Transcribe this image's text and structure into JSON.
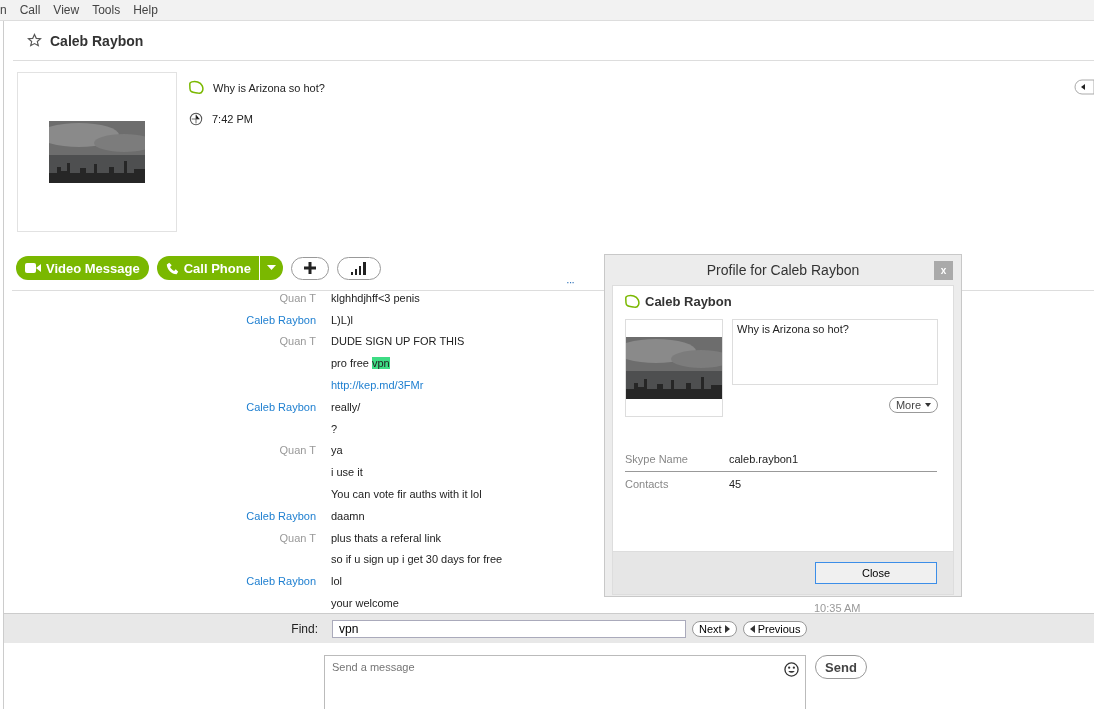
{
  "menu": [
    "n",
    "Call",
    "View",
    "Tools",
    "Help"
  ],
  "header": {
    "name": "Caleb Raybon",
    "favorite": false
  },
  "profile": {
    "mood": "Why is Arizona so hot?",
    "local_time": "7:42 PM"
  },
  "actions": {
    "video": "Video Message",
    "call": "Call Phone"
  },
  "messages": [
    {
      "sender": "Quan T",
      "from_contact": false,
      "text": "klghhdjhff<3 penis"
    },
    {
      "sender": "Caleb Raybon",
      "from_contact": true,
      "text": "L)L)l"
    },
    {
      "sender": "Quan T",
      "from_contact": false,
      "text": "DUDE SIGN UP FOR THIS"
    },
    {
      "text": "pro free ",
      "highlight": "vpn"
    },
    {
      "text": "http://kep.md/3FMr",
      "kind": "link"
    },
    {
      "sender": "Caleb Raybon",
      "from_contact": true,
      "text": "really/"
    },
    {
      "text": "?"
    },
    {
      "sender": "Quan T",
      "from_contact": false,
      "text": "ya"
    },
    {
      "text": "i use it"
    },
    {
      "text": "You can vote fir auths with it lol"
    },
    {
      "sender": "Caleb Raybon",
      "from_contact": true,
      "text": "daamn"
    },
    {
      "sender": "Quan T",
      "from_contact": false,
      "text": "plus thats a referal link"
    },
    {
      "text": "so if u sign up i get 30 days for free"
    },
    {
      "sender": "Caleb Raybon",
      "from_contact": true,
      "text": "lol"
    },
    {
      "text": "your welcome",
      "time": "10:35 AM"
    }
  ],
  "divider_handle": "···",
  "find": {
    "label": "Find:",
    "value": "vpn",
    "next": "Next",
    "previous": "Previous"
  },
  "composer": {
    "placeholder": "Send a message",
    "send": "Send"
  },
  "dialog": {
    "title": "Profile for Caleb Raybon",
    "close_x": "x",
    "name": "Caleb Raybon",
    "mood": "Why is Arizona so hot?",
    "more": "More",
    "fields": [
      {
        "label": "Skype Name",
        "value": "caleb.raybon1"
      },
      {
        "label": "Contacts",
        "value": "45"
      }
    ],
    "close": "Close"
  }
}
